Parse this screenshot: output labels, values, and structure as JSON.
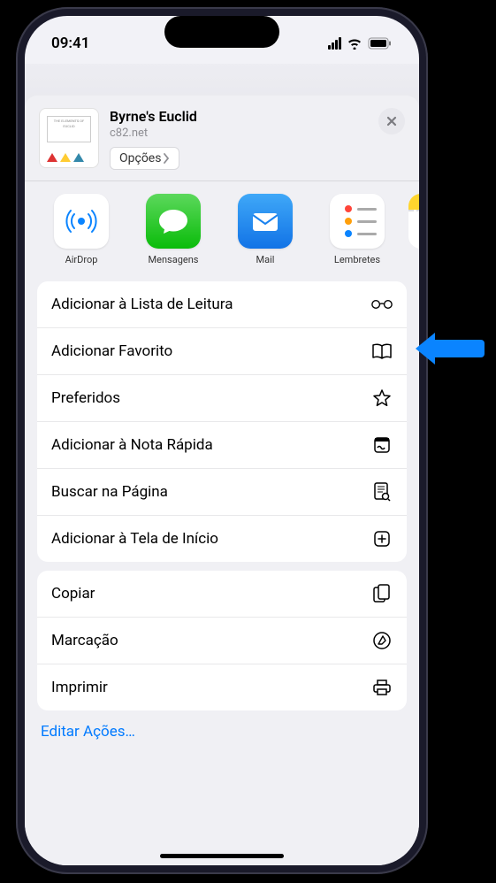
{
  "status": {
    "time": "09:41"
  },
  "header": {
    "title": "Byrne's Euclid",
    "subtitle": "c82.net",
    "thumb_text": "THE ELEMENTS OF EUCLID",
    "options_label": "Opções"
  },
  "apps": [
    {
      "name": "airdrop",
      "label": "AirDrop"
    },
    {
      "name": "messages",
      "label": "Mensagens"
    },
    {
      "name": "mail",
      "label": "Mail"
    },
    {
      "name": "reminders",
      "label": "Lembretes"
    },
    {
      "name": "notes",
      "label": ""
    }
  ],
  "actions_group1": [
    {
      "id": "reading-list",
      "label": "Adicionar à Lista de Leitura",
      "icon": "glasses"
    },
    {
      "id": "bookmark",
      "label": "Adicionar Favorito",
      "icon": "book"
    },
    {
      "id": "favorites",
      "label": "Preferidos",
      "icon": "star"
    },
    {
      "id": "quick-note",
      "label": "Adicionar à Nota Rápida",
      "icon": "note"
    },
    {
      "id": "find",
      "label": "Buscar na Página",
      "icon": "doc-search"
    },
    {
      "id": "homescreen",
      "label": "Adicionar à Tela de Início",
      "icon": "plus-square"
    }
  ],
  "actions_group2": [
    {
      "id": "copy",
      "label": "Copiar",
      "icon": "copy"
    },
    {
      "id": "markup",
      "label": "Marcação",
      "icon": "markup"
    },
    {
      "id": "print",
      "label": "Imprimir",
      "icon": "print"
    }
  ],
  "edit_actions_label": "Editar Ações…"
}
